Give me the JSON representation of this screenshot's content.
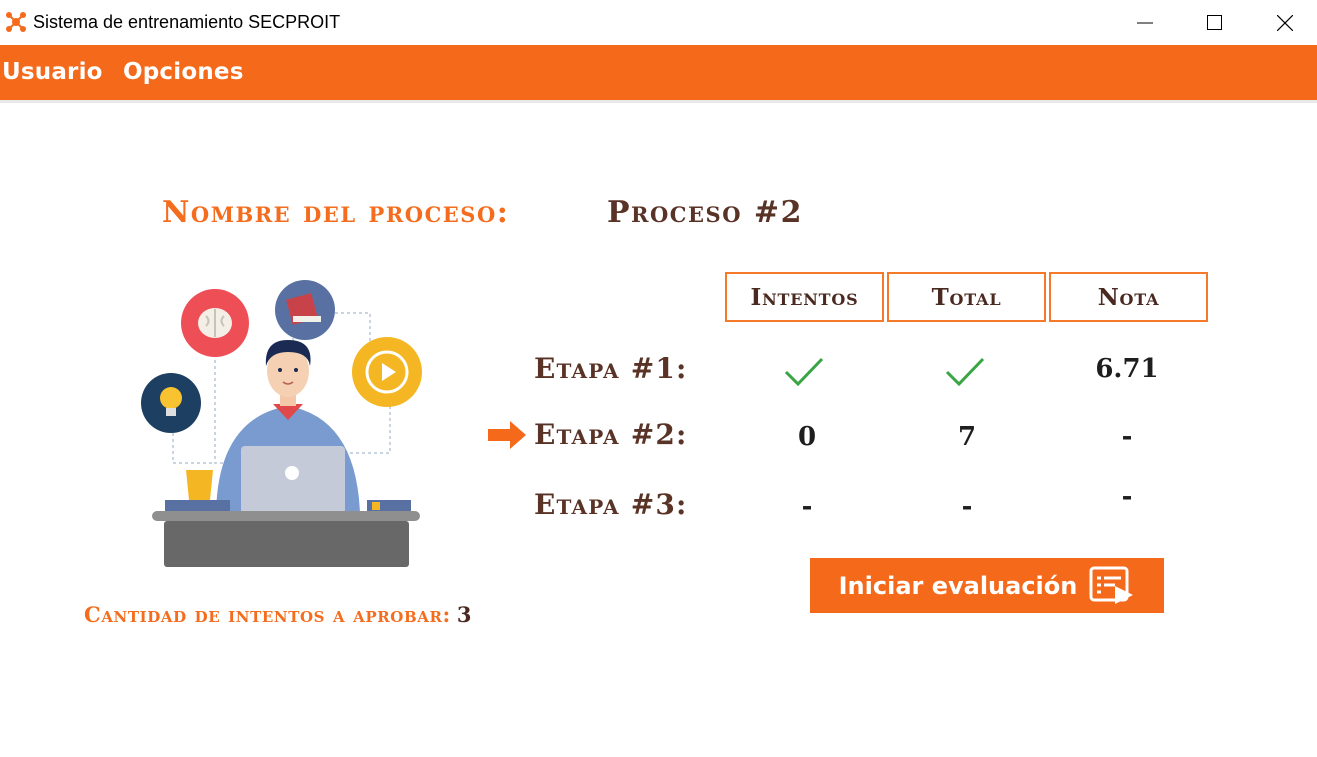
{
  "window": {
    "title": "Sistema de entrenamiento SECPROIT",
    "app_icon": "orange-network-icon",
    "controls": [
      "minimize-icon",
      "maximize-icon",
      "close-icon"
    ]
  },
  "menu": {
    "items": [
      {
        "label": "Usuario"
      },
      {
        "label": "Opciones"
      }
    ]
  },
  "process": {
    "label": "Nombre del proceso:",
    "name": "Proceso #2"
  },
  "table": {
    "headers": [
      "Intentos",
      "Total",
      "Nota"
    ],
    "rows": [
      {
        "stage": "Etapa #1:",
        "intentos": "check",
        "total": "check",
        "nota": "6.71"
      },
      {
        "stage": "Etapa #2:",
        "intentos": "0",
        "total": "7",
        "nota": "-",
        "current": true
      },
      {
        "stage": "Etapa #3:",
        "intentos": "-",
        "total": "-",
        "nota": "-"
      }
    ]
  },
  "start_button": {
    "label": "Iniciar evaluación",
    "icon": "evaluation-play-icon"
  },
  "attempts": {
    "label": "Cantidad de intentos a aprobar:",
    "value": "3"
  },
  "colors": {
    "accent": "#f5691b",
    "heading": "#5a3327",
    "check": "#3aa545"
  }
}
